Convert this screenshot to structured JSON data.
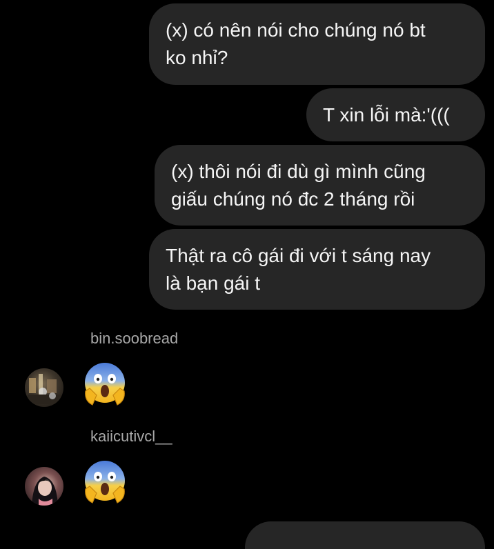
{
  "thread": {
    "outgoing": [
      {
        "text": "(x) có nên nói cho chúng nó bt\nko nhỉ?"
      },
      {
        "text": "T xin lỗi mà:'((("
      },
      {
        "text": "(x) thôi nói đi dù gì mình cũng\ngiấu chúng nó đc 2 tháng rồi"
      },
      {
        "text": "Thật ra cô gái đi với t sáng nay\nlà bạn gái t"
      }
    ],
    "incoming": [
      {
        "username": "bin.soobread",
        "emoji": "😱",
        "emoji_name": "face-screaming-in-fear-icon"
      },
      {
        "username": "kaiicutivcl__",
        "emoji": "😱",
        "emoji_name": "face-screaming-in-fear-icon"
      }
    ]
  },
  "colors": {
    "background": "#000000",
    "bubble": "#262626",
    "bubble_text": "#f5f5f5",
    "username": "#a8a8a8"
  }
}
